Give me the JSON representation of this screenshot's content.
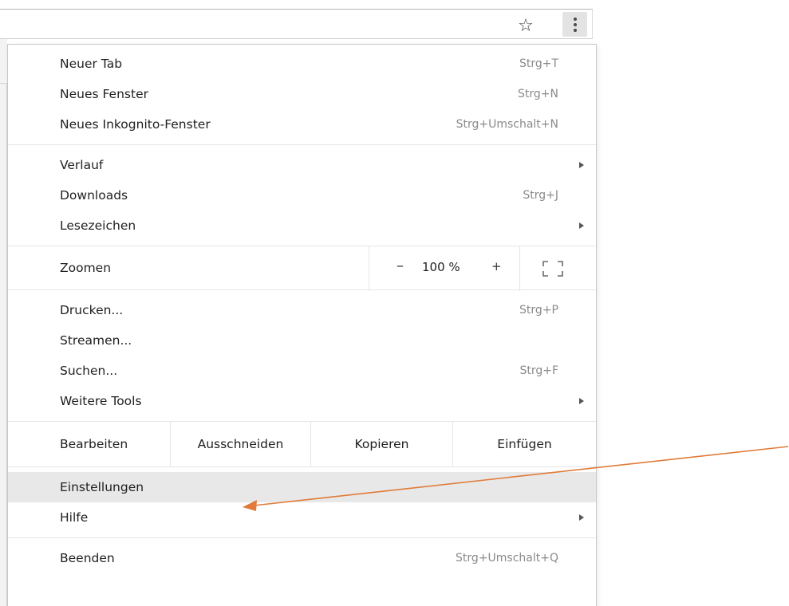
{
  "toolbar": {
    "bookmark_icon": "star-icon",
    "menu_icon": "kebab-menu-icon"
  },
  "menu": {
    "group1": [
      {
        "label": "Neuer Tab",
        "shortcut": "Strg+T"
      },
      {
        "label": "Neues Fenster",
        "shortcut": "Strg+N"
      },
      {
        "label": "Neues Inkognito-Fenster",
        "shortcut": "Strg+Umschalt+N"
      }
    ],
    "group2": [
      {
        "label": "Verlauf",
        "shortcut": ""
      },
      {
        "label": "Downloads",
        "shortcut": "Strg+J"
      },
      {
        "label": "Lesezeichen",
        "shortcut": ""
      }
    ],
    "zoom": {
      "label": "Zoomen",
      "minus": "–",
      "value": "100 %",
      "plus": "+"
    },
    "group3": [
      {
        "label": "Drucken...",
        "shortcut": "Strg+P"
      },
      {
        "label": "Streamen...",
        "shortcut": ""
      },
      {
        "label": "Suchen...",
        "shortcut": "Strg+F"
      },
      {
        "label": "Weitere Tools",
        "shortcut": ""
      }
    ],
    "edit": {
      "label": "Bearbeiten",
      "cut": "Ausschneiden",
      "copy": "Kopieren",
      "paste": "Einfügen"
    },
    "group4": [
      {
        "label": "Einstellungen",
        "shortcut": ""
      },
      {
        "label": "Hilfe",
        "shortcut": ""
      }
    ],
    "group5": [
      {
        "label": "Beenden",
        "shortcut": "Strg+Umschalt+Q"
      }
    ]
  },
  "colors": {
    "highlight": "#e8e8e8",
    "annotation_arrow": "#e07b39",
    "shortcut_text": "#8a8a8a"
  }
}
